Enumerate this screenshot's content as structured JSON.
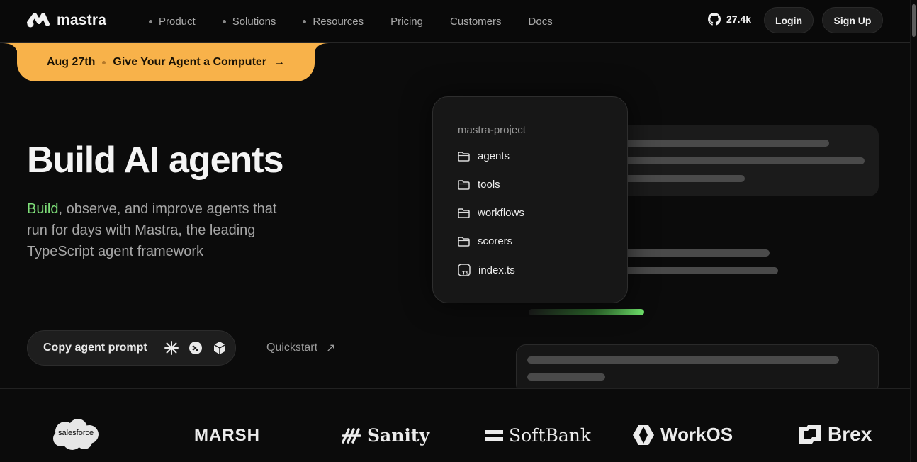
{
  "nav": {
    "brand": "mastra",
    "items": [
      {
        "label": "Product",
        "dot": true
      },
      {
        "label": "Solutions",
        "dot": true
      },
      {
        "label": "Resources",
        "dot": true
      },
      {
        "label": "Pricing",
        "dot": false
      },
      {
        "label": "Customers",
        "dot": false
      },
      {
        "label": "Docs",
        "dot": false
      }
    ],
    "github_stars": "27.4k",
    "login_label": "Login",
    "signup_label": "Sign Up"
  },
  "banner": {
    "date": "Aug 27th",
    "text": "Give Your Agent a Computer",
    "arrow": "→"
  },
  "hero": {
    "title": "Build AI agents",
    "subtitle_highlight": "Build",
    "subtitle_rest": ", observe, and improve agents that run for days with Mastra, the leading TypeScript agent framework",
    "copy_prompt_label": "Copy agent prompt",
    "quickstart_label": "Quickstart",
    "quickstart_arrow": "↗"
  },
  "file_tree": {
    "title": "mastra-project",
    "items": [
      {
        "label": "agents",
        "icon": "folder-icon"
      },
      {
        "label": "tools",
        "icon": "folder-icon"
      },
      {
        "label": "workflows",
        "icon": "folder-icon"
      },
      {
        "label": "scorers",
        "icon": "folder-icon"
      },
      {
        "label": "index.ts",
        "icon": "typescript-file-icon"
      }
    ]
  },
  "logos": {
    "salesforce": "salesforce",
    "marsh": "MARSH",
    "sanity": "Sanity",
    "softbank": "SoftBank",
    "workos": "WorkOS",
    "brex": "Brex"
  },
  "colors": {
    "accent_orange": "#f8b24a",
    "highlight_green": "#7fe07a",
    "background": "#0b0b0b"
  }
}
